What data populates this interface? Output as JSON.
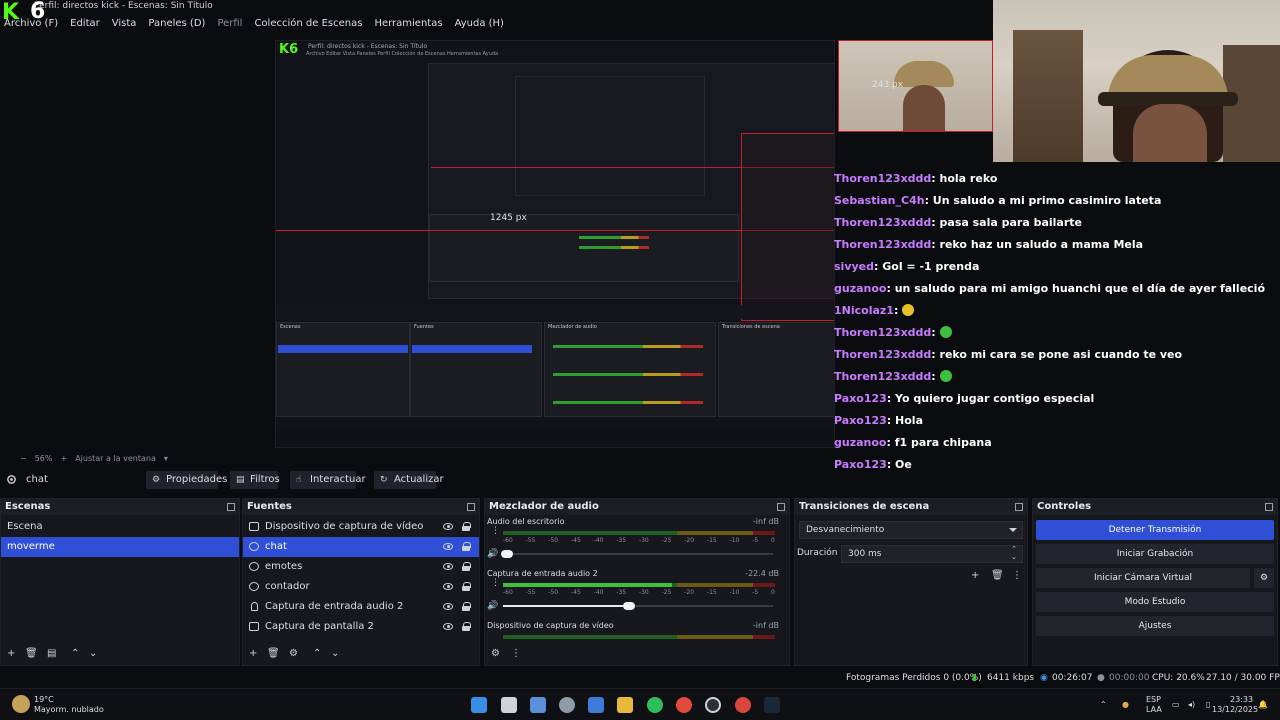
{
  "window": {
    "title": "Perfil: directos kick - Escenas: Sin Título",
    "logo_text": "K",
    "logo_num": "6"
  },
  "menu": [
    "Archivo (F)",
    "Editar",
    "Vista",
    "Paneles (D)",
    "Perfil",
    "Colección de Escenas",
    "Herramientas",
    "Ayuda (H)"
  ],
  "preview": {
    "measure_1": "1245 px",
    "measure_2": "243 px",
    "zoom": "56%",
    "fit_label": "Ajustar a la ventana"
  },
  "chat_overlay": [
    {
      "user": "Thoren123xddd",
      "msg": ": hola reko",
      "emote": ""
    },
    {
      "user": "Sebastian_C4h",
      "msg": ": Un saludo a mi primo casimiro lateta",
      "emote": ""
    },
    {
      "user": "Thoren123xddd",
      "msg": ": pasa sala para bailarte",
      "emote": ""
    },
    {
      "user": "Thoren123xddd",
      "msg": ": reko haz un saludo a mama Mela",
      "emote": ""
    },
    {
      "user": "sivyed",
      "msg": ": Gol = -1 prenda",
      "emote": ""
    },
    {
      "user": "guzanoo",
      "msg": ": un saludo para mi amigo huanchi que el día de ayer falleció",
      "emote": ""
    },
    {
      "user": "1Nicolaz1",
      "msg": ":",
      "emote": "yellow"
    },
    {
      "user": "Thoren123xddd",
      "msg": ":",
      "emote": "green"
    },
    {
      "user": "Thoren123xddd",
      "msg": ": reko mi cara se pone asi cuando te veo",
      "emote": ""
    },
    {
      "user": "Thoren123xddd",
      "msg": ":",
      "emote": "green"
    },
    {
      "user": "Paxo123",
      "msg": ": Yo quiero jugar contigo especial",
      "emote": ""
    },
    {
      "user": "Paxo123",
      "msg": ": Hola",
      "emote": ""
    },
    {
      "user": "guzanoo",
      "msg": ": f1 para chipana",
      "emote": ""
    },
    {
      "user": "Paxo123",
      "msg": ": Oe",
      "emote": ""
    }
  ],
  "source_toolbar": {
    "current_source": "chat",
    "properties": "Propiedades",
    "filters": "Filtros",
    "interact": "Interactuar",
    "refresh": "Actualizar"
  },
  "scenes": {
    "title": "Escenas",
    "items": [
      "Escena",
      "moverme"
    ],
    "selected": "moverme"
  },
  "sources": {
    "title": "Fuentes",
    "items": [
      "Dispositivo de captura de vídeo",
      "chat",
      "emotes",
      "contador",
      "Captura de entrada audio 2",
      "Captura de pantalla 2"
    ],
    "selected": "chat"
  },
  "mixer": {
    "title": "Mezclador de audio",
    "channels": [
      {
        "name": "Audio del escritorio",
        "db": "-inf dB",
        "level": 0.0,
        "volume": 0.0
      },
      {
        "name": "Captura de entrada audio 2",
        "db": "-22.4 dB",
        "level": 0.62,
        "volume": 0.45
      },
      {
        "name": "Dispositivo de captura de vídeo",
        "db": "-inf dB",
        "level": 0.0,
        "volume": 0.0
      }
    ],
    "ticks": [
      "-60",
      "-55",
      "-50",
      "-45",
      "-40",
      "-35",
      "-30",
      "-25",
      "-20",
      "-15",
      "-10",
      "-5",
      "0"
    ]
  },
  "transitions": {
    "title": "Transiciones de escena",
    "selected": "Desvanecimiento",
    "duration_label": "Duración",
    "duration_value": "300 ms"
  },
  "controls": {
    "title": "Controles",
    "buttons": [
      "Detener Transmisión",
      "Iniciar Grabación",
      "Iniciar Cámara Virtual",
      "Modo Estudio",
      "Ajustes"
    ]
  },
  "status": {
    "dropped_frames": "Fotogramas Perdidos 0 (0.0%)",
    "bitrate": "6411 kbps",
    "live_time": "00:26:07",
    "rec_time": "00:00:00",
    "cpu": "CPU: 20.6%",
    "fps": "27.10 / 30.00 FPS"
  },
  "taskbar": {
    "weather_temp": "19°C",
    "weather_desc": "Mayorm. nublado",
    "lang_1": "ESP",
    "lang_2": "LAA",
    "time": "23:33",
    "date": "13/12/2025"
  },
  "colors": {
    "accent": "#2f4fd6",
    "chat_user": "#c97cff",
    "kick_green": "#53fc18",
    "live_red": "#c41e2b"
  }
}
